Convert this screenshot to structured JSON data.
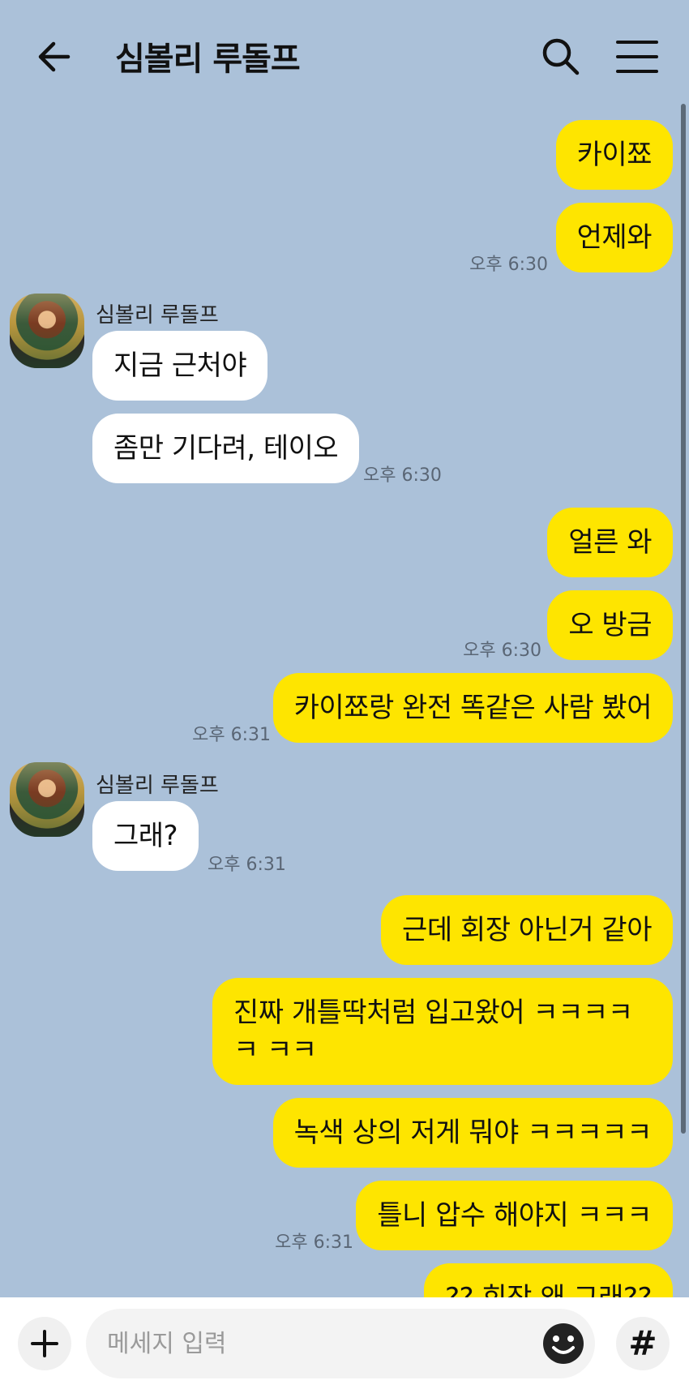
{
  "header": {
    "title": "심볼리 루돌프",
    "back_icon": "arrow-left-icon",
    "search_icon": "search-icon",
    "menu_icon": "hamburger-menu-icon"
  },
  "colors": {
    "background": "#abc1d9",
    "my_bubble": "#fee500",
    "their_bubble": "#ffffff"
  },
  "messages": [
    {
      "from": "me",
      "text": "카이쬬"
    },
    {
      "from": "me",
      "text": "언제와",
      "time": "오후 6:30"
    },
    {
      "from": "other",
      "sender": "심볼리 루돌프",
      "text": "지금 근처야"
    },
    {
      "from": "other",
      "text": "좀만 기다려, 테이오",
      "time": "오후 6:30"
    },
    {
      "from": "me",
      "text": "얼른 와"
    },
    {
      "from": "me",
      "text": "오 방금",
      "time": "오후 6:30"
    },
    {
      "from": "me",
      "text": "카이쬬랑 완전 똑같은 사람 봤어",
      "time": "오후 6:31"
    },
    {
      "from": "other",
      "sender": "심볼리 루돌프",
      "text": "그래?",
      "time": "오후 6:31"
    },
    {
      "from": "me",
      "text": "근데 회장 아닌거 같아"
    },
    {
      "from": "me",
      "text": "진짜 개틀딱처럼 입고왔어 ㅋㅋㅋㅋㅋ ㅋㅋ"
    },
    {
      "from": "me",
      "text": "녹색 상의 저게 뭐야 ㅋㅋㅋㅋㅋ"
    },
    {
      "from": "me",
      "text": "틀니 압수 해야지 ㅋㅋㅋ",
      "time": "오후 6:31"
    },
    {
      "from": "me",
      "text": "?? 회장 왜 그래??"
    }
  ],
  "composer": {
    "placeholder": "메세지 입력",
    "plus_icon": "plus-icon",
    "emoji_icon": "smiley-icon",
    "hash_label": "#"
  }
}
